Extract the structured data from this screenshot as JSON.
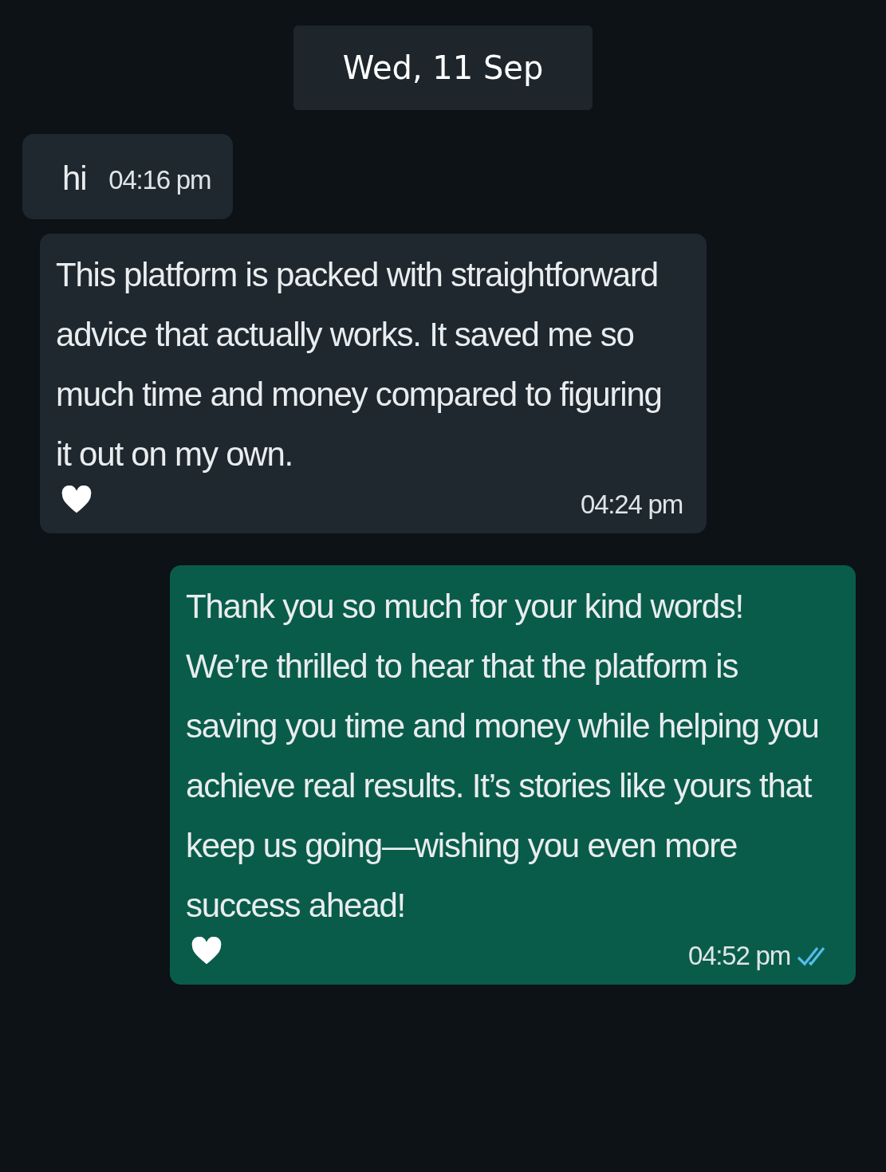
{
  "date_chip": "Wed, 11 Sep",
  "messages": [
    {
      "kind": "incoming",
      "text": "hi",
      "time": "04:16 pm",
      "heart": false
    },
    {
      "kind": "incoming",
      "text": "This platform is packed with straightforward advice that actually works. It saved me so much time and money compared to figuring it out on my own.",
      "time": "04:24 pm",
      "heart": true
    },
    {
      "kind": "outgoing",
      "text": "Thank you so much for your kind words! We’re thrilled to hear that the platform is saving you time and money while helping you achieve real results. It’s stories like yours that keep us going—wishing you even more success ahead!",
      "time": "04:52 pm",
      "heart": true
    }
  ]
}
